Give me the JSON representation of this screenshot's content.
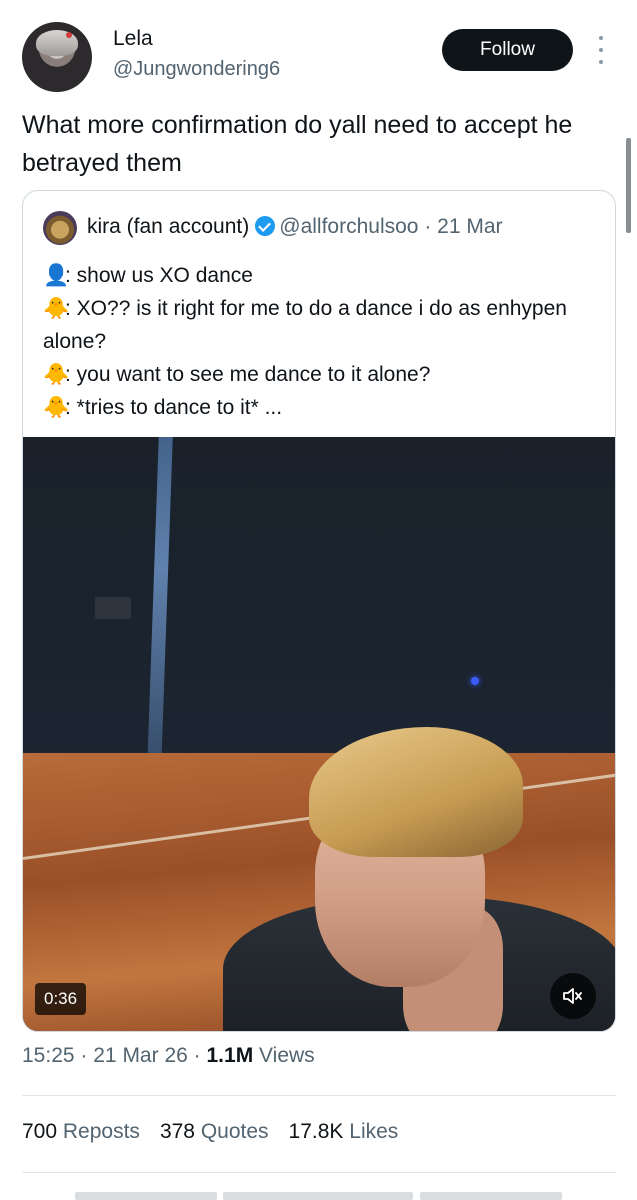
{
  "author": {
    "name": "Lela",
    "handle": "@Jungwondering6"
  },
  "follow_label": "Follow",
  "tweet_text": "What more confirmation do yall need to accept he betrayed them",
  "quoted": {
    "name": "kira (fan account)",
    "handle": "@allforchulsoo",
    "separator": "·",
    "date": "21 Mar",
    "lines": [
      {
        "icon": "person-emoji-icon",
        "glyph": "👤",
        "text": ": show us XO dance"
      },
      {
        "icon": "chick-emoji-icon",
        "glyph": "🐥",
        "text": ": XO?? is it right for me to do a dance i do as enhypen alone?"
      },
      {
        "icon": "chick-emoji-icon",
        "glyph": "🐥",
        "text": ": you want to see me dance to it alone?"
      },
      {
        "icon": "chick-emoji-icon",
        "glyph": "🐥",
        "text": ": *tries to dance to it* ..."
      }
    ],
    "video_duration": "0:36"
  },
  "meta": {
    "time": "15:25",
    "sep1": "·",
    "date": "21 Mar 26",
    "sep2": "·",
    "views_count": "1.1M",
    "views_label": "Views"
  },
  "stats": {
    "reposts_count": "700",
    "reposts_label": "Reposts",
    "quotes_count": "378",
    "quotes_label": "Quotes",
    "likes_count": "17.8K",
    "likes_label": "Likes"
  },
  "colors": {
    "verified": "#1d9bf0",
    "follow_bg": "#0f1419",
    "secondary_text": "#536471"
  }
}
